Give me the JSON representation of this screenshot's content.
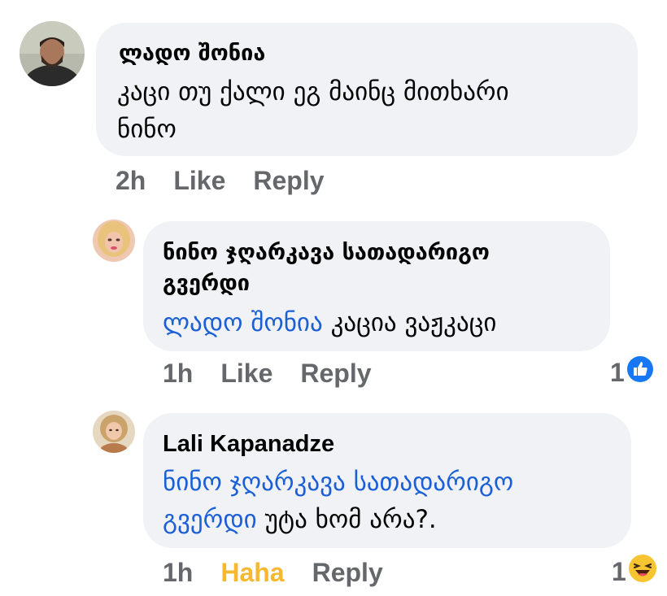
{
  "comments": [
    {
      "author": "ლადო შონია",
      "text_line1": "კაცი თუ ქალი ეგ მაინც მითხარი",
      "text_line2": "ნინო",
      "time": "2h",
      "like_label": "Like",
      "reply_label": "Reply"
    },
    {
      "author_line1": "ნინო ჯღარკავა სათადარიგო",
      "author_line2": "გვერდი",
      "mention": "ლადო შონია",
      "text": " კაცია ვაჟკაცი",
      "time": "1h",
      "like_label": "Like",
      "reply_label": "Reply",
      "reaction_count": "1",
      "reaction_icon": "like-icon"
    },
    {
      "author": "Lali Kapanadze",
      "mention_line1": "ნინო ჯღარკავა სათადარიგო",
      "mention_line2": "გვერდი",
      "text": " უტა ხომ არა?.",
      "time": "1h",
      "reaction_label": "Haha",
      "reply_label": "Reply",
      "reaction_count": "1",
      "reaction_icon": "haha-emoji-icon"
    }
  ],
  "colors": {
    "bubble": "#f0f2f5",
    "mention": "#1b5fd6",
    "meta": "#65676b",
    "haha": "#f5b82e",
    "like_blue": "#1877f2"
  }
}
